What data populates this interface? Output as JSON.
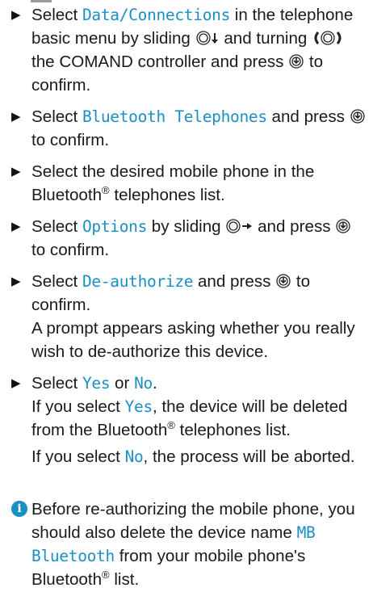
{
  "steps": [
    {
      "p1": "Select ",
      "menu": "Data/Connections",
      "p2": " in the telephone basic menu by sliding ",
      "p3": " and turning ",
      "p4": " the COMAND controller and press ",
      "p5": " to confirm."
    },
    {
      "p1": "Select ",
      "menu": "Bluetooth Telephones",
      "p2": " and press ",
      "p3": " to confirm."
    },
    {
      "p1": "Select the desired mobile phone in the Bluetooth",
      "reg": "®",
      "p2": " telephones list."
    },
    {
      "p1": "Select ",
      "menu": "Options",
      "p2": " by sliding ",
      "p3": " and press ",
      "p4": " to confirm."
    },
    {
      "p1": "Select ",
      "menu": "De-authorize",
      "p2": " and press ",
      "p3": " to confirm.",
      "result": "A prompt appears asking whether you really wish to de-authorize this device."
    },
    {
      "p1": "Select ",
      "menu_yes": "Yes",
      "p2": " or ",
      "menu_no": "No",
      "p3": ".",
      "r1a": "If you select ",
      "r1b": ", the device will be deleted from the Bluetooth",
      "reg": "®",
      "r1c": " telephones list.",
      "r2a": "If you select ",
      "r2b": ", the process will be aborted."
    }
  ],
  "note": {
    "p1": "Before re-authorizing the mobile phone, you should also delete the device name ",
    "menu": "MB Bluetooth",
    "p2": " from your mobile phone's Bluetooth",
    "reg": "®",
    "p3": " list."
  },
  "icons": {
    "step_marker": "triangle-right",
    "info": "info-circle",
    "accent": "#1a8fc4"
  }
}
